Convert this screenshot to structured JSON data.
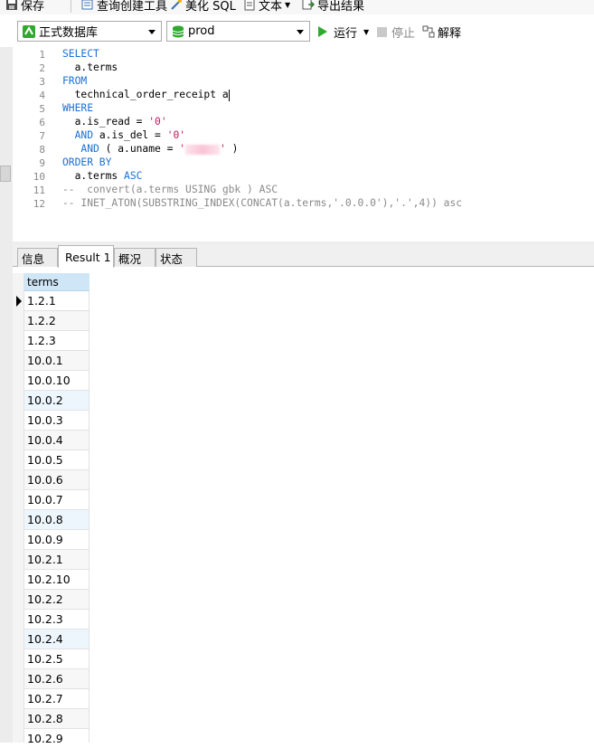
{
  "toolbar": {
    "save_label": "保存",
    "query_builder_label": "查询创建工具",
    "beautify_label": "美化 SQL",
    "text_label": "文本",
    "export_label": "导出结果"
  },
  "toolbar2": {
    "connection": "正式数据库",
    "database": "prod",
    "run_label": "运行",
    "stop_label": "停止",
    "explain_label": "解释"
  },
  "editor": {
    "line_numbers": [
      "1",
      "2",
      "3",
      "4",
      "5",
      "6",
      "7",
      "8",
      "9",
      "10",
      "11",
      "12"
    ]
  },
  "tabs": [
    "信息",
    "Result 1",
    "概况",
    "状态"
  ],
  "grid": {
    "column": "terms",
    "rows": [
      "1.2.1",
      "1.2.2",
      "1.2.3",
      "10.0.1",
      "10.0.10",
      "10.0.2",
      "10.0.3",
      "10.0.4",
      "10.0.5",
      "10.0.6",
      "10.0.7",
      "10.0.8",
      "10.0.9",
      "10.2.1",
      "10.2.10",
      "10.2.2",
      "10.2.3",
      "10.2.4",
      "10.2.5",
      "10.2.6",
      "10.2.7",
      "10.2.8",
      "10.2.9"
    ]
  },
  "colors": {
    "keyword": "#1a6fd4",
    "string": "#c2185b",
    "comment": "#8a8a8a",
    "header": "#cfe6f7",
    "run_green": "#2eaa2e"
  }
}
